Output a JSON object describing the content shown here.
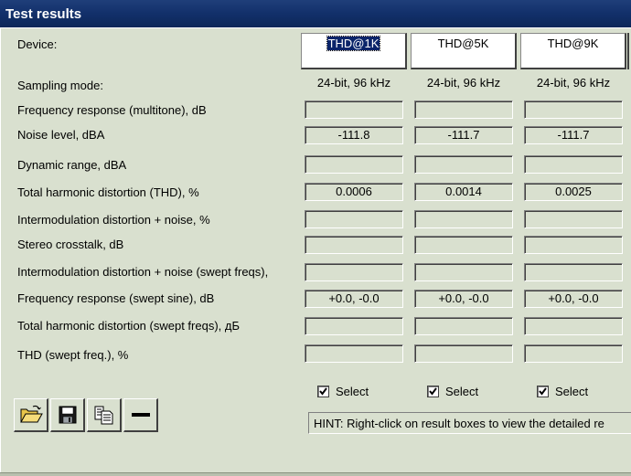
{
  "window": {
    "title": "Test results"
  },
  "labels": {
    "device": "Device:",
    "sampling_mode": "Sampling mode:"
  },
  "devices": [
    {
      "name": "THD@1K",
      "selected": true,
      "mode": "24-bit, 96 kHz",
      "select_label": "Select",
      "checked": true
    },
    {
      "name": "THD@5K",
      "selected": false,
      "mode": "24-bit, 96 kHz",
      "select_label": "Select",
      "checked": true
    },
    {
      "name": "THD@9K",
      "selected": false,
      "mode": "24-bit, 96 kHz",
      "select_label": "Select",
      "checked": true
    }
  ],
  "rows": [
    {
      "label": "Frequency response (multitone), dB",
      "values": [
        "",
        "",
        ""
      ]
    },
    {
      "label": "Noise level, dBA",
      "values": [
        "-111.8",
        "-111.7",
        "-111.7"
      ]
    },
    {
      "label": "Dynamic range, dBA",
      "values": [
        "",
        "",
        ""
      ]
    },
    {
      "label": "Total harmonic distortion (THD), %",
      "values": [
        "0.0006",
        "0.0014",
        "0.0025"
      ]
    },
    {
      "label": "Intermodulation distortion + noise, %",
      "values": [
        "",
        "",
        ""
      ]
    },
    {
      "label": "Stereo crosstalk, dB",
      "values": [
        "",
        "",
        ""
      ]
    },
    {
      "label": "Intermodulation distortion + noise (swept freqs),",
      "values": [
        "",
        "",
        ""
      ]
    },
    {
      "label": "Frequency response (swept sine), dB",
      "values": [
        "+0.0, -0.0",
        "+0.0, -0.0",
        "+0.0, -0.0"
      ]
    },
    {
      "label": "Total harmonic distortion (swept freqs), дБ",
      "values": [
        "",
        "",
        ""
      ]
    },
    {
      "label": "THD (swept freq.), %",
      "values": [
        "",
        "",
        ""
      ]
    }
  ],
  "toolbar": [
    {
      "name": "open-button",
      "icon": "folder-open-icon"
    },
    {
      "name": "save-button",
      "icon": "floppy-disk-icon"
    },
    {
      "name": "copy-button",
      "icon": "copy-icon"
    },
    {
      "name": "remove-button",
      "icon": "minus-icon"
    }
  ],
  "hint": "HINT: Right-click on result boxes to view the detailed re"
}
